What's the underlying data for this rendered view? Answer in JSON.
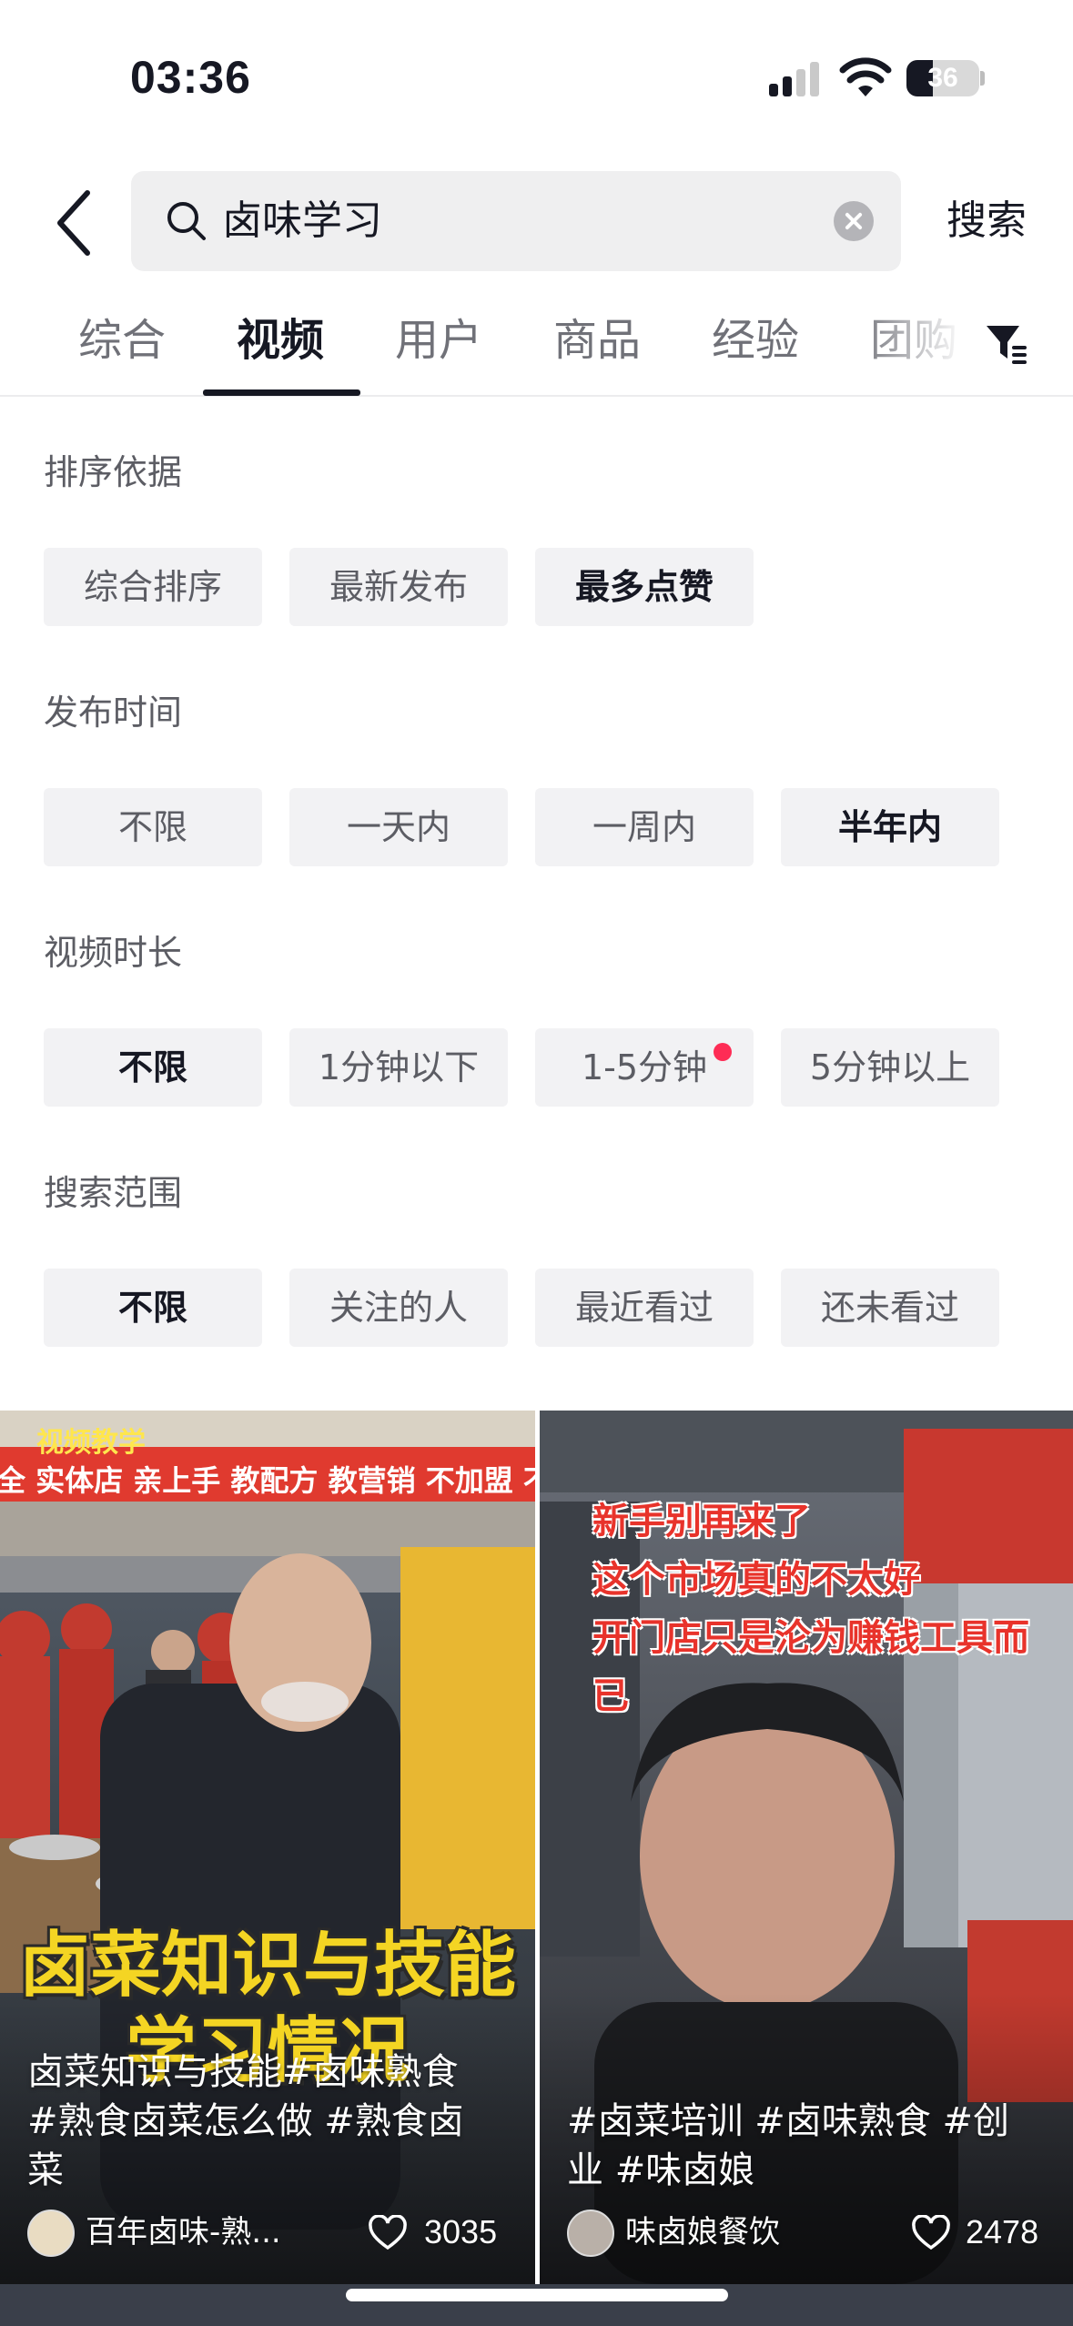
{
  "status_bar": {
    "time": "03:36",
    "battery_level": "36",
    "battery_fraction": 0.36
  },
  "search": {
    "query": "卤味学习",
    "submit_label": "搜索"
  },
  "tabs": [
    {
      "label": "综合"
    },
    {
      "label": "视频"
    },
    {
      "label": "用户"
    },
    {
      "label": "商品"
    },
    {
      "label": "经验"
    },
    {
      "label": "团购"
    }
  ],
  "active_tab": "视频",
  "filters": {
    "sort": {
      "title": "排序依据",
      "options": [
        "综合排序",
        "最新发布",
        "最多点赞"
      ],
      "selected": "最多点赞"
    },
    "time": {
      "title": "发布时间",
      "options": [
        "不限",
        "一天内",
        "一周内",
        "半年内"
      ],
      "selected": "半年内"
    },
    "duration": {
      "title": "视频时长",
      "options": [
        "不限",
        "1分钟以下",
        "1-5分钟",
        "5分钟以上"
      ],
      "selected": "不限",
      "dot_on": "1-5分钟"
    },
    "scope": {
      "title": "搜索范围",
      "options": [
        "不限",
        "关注的人",
        "最近看过",
        "还未看过"
      ],
      "selected": "不限"
    }
  },
  "videos": [
    {
      "banner_top": "视频教学",
      "banner": "全 实体店 亲上手 教配方 教营销 不加盟 不要料",
      "overlay_title_line1": "卤菜知识与技能",
      "overlay_title_line2": "学习情况",
      "caption": "卤菜知识与技能#卤味熟食 #熟食卤菜怎么做 #熟食卤菜",
      "author": "百年卤味-熟...",
      "likes": "3035"
    },
    {
      "overlay_lines": [
        "新手别再来了",
        "这个市场真的不太好",
        "开门店只是沦为赚钱工具而",
        "已"
      ],
      "caption": "#卤菜培训 #卤味熟食 #创业 #味卤娘",
      "author": "味卤娘餐饮",
      "likes": "2478"
    }
  ],
  "colors": {
    "accent_dot": "#fe2c55",
    "chip_bg": "#f2f2f4",
    "text_primary": "#161823",
    "text_secondary": "#5c5d64"
  },
  "icons": [
    "back-icon",
    "search-icon",
    "clear-icon",
    "filter-icon",
    "heart-icon",
    "wifi-icon",
    "signal-icon",
    "battery-icon"
  ]
}
